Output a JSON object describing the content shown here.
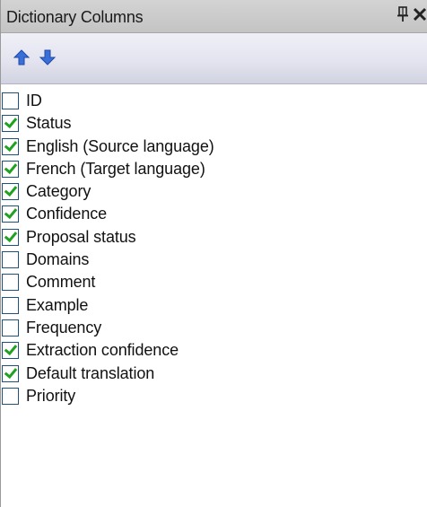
{
  "panel": {
    "title": "Dictionary Columns",
    "pin_icon": "pin-icon",
    "close_icon": "close-icon"
  },
  "toolbar": {
    "move_up_icon": "arrow-up-icon",
    "move_down_icon": "arrow-down-icon",
    "arrow_color": "#3a6fd8"
  },
  "columns": [
    {
      "label": "ID",
      "checked": false
    },
    {
      "label": "Status",
      "checked": true
    },
    {
      "label": "English (Source language)",
      "checked": true
    },
    {
      "label": "French (Target language)",
      "checked": true
    },
    {
      "label": "Category",
      "checked": true
    },
    {
      "label": "Confidence",
      "checked": true
    },
    {
      "label": "Proposal status",
      "checked": true
    },
    {
      "label": "Domains",
      "checked": false
    },
    {
      "label": "Comment",
      "checked": false
    },
    {
      "label": "Example",
      "checked": false
    },
    {
      "label": "Frequency",
      "checked": false
    },
    {
      "label": "Extraction confidence",
      "checked": true
    },
    {
      "label": "Default translation",
      "checked": true
    },
    {
      "label": "Priority",
      "checked": false
    }
  ]
}
